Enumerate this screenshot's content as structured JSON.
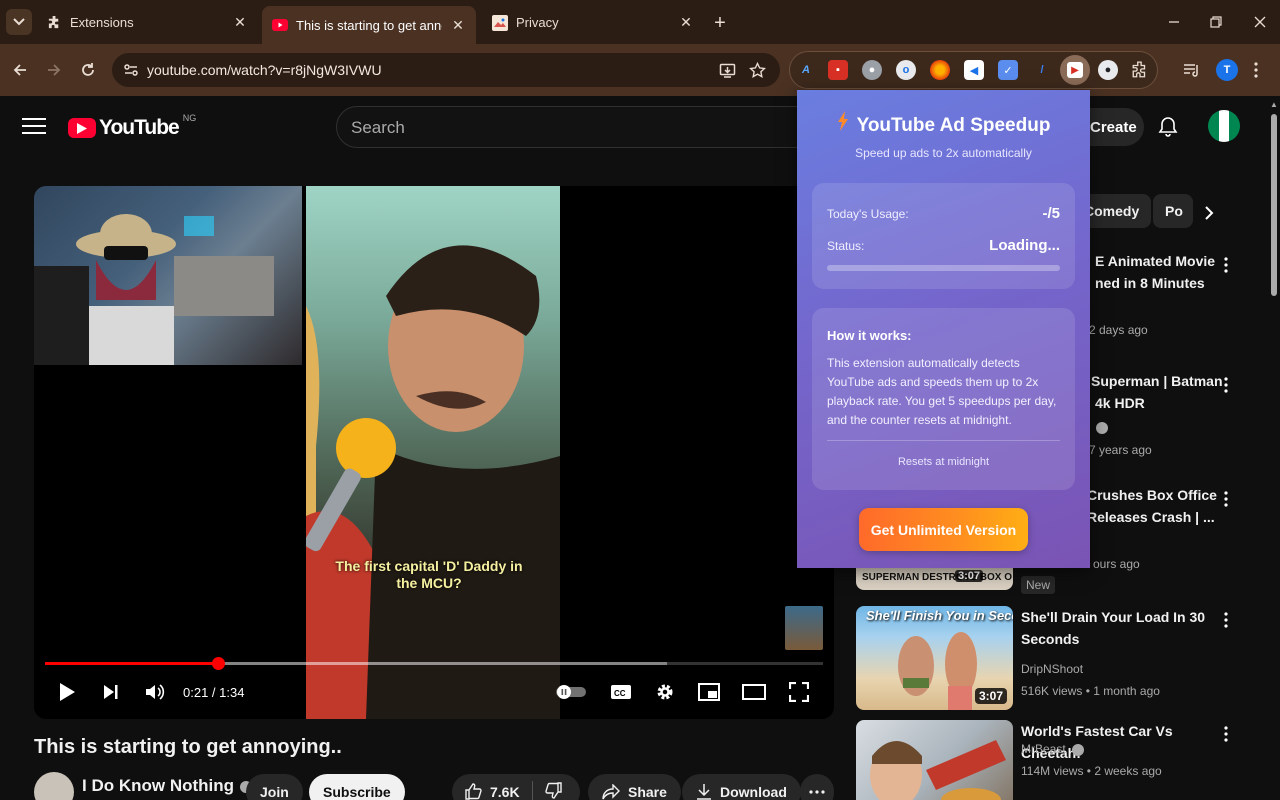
{
  "browser": {
    "tabs": [
      {
        "title": "Extensions",
        "icon": "puzzle-icon",
        "active": false
      },
      {
        "title": "This is starting to get annoying..",
        "icon": "youtube-favicon",
        "active": true
      },
      {
        "title": "Privacy",
        "icon": "privacy-favicon",
        "active": false
      }
    ],
    "url": "youtube.com/watch?v=r8jNgW3IVWU",
    "profile_initial": "T"
  },
  "youtube": {
    "logo_text": "YouTube",
    "country_code": "NG",
    "search_placeholder": "Search",
    "create_label": "Create",
    "chips": [
      "Comedy",
      "Po"
    ],
    "player": {
      "caption": "The first capital 'D' Daddy in the MCU?",
      "time": "0:21 / 1:34",
      "played_fraction": 0.223,
      "buffered_fraction": 0.8
    },
    "video_title": "This is starting to get annoying..",
    "channel_name": "I Do Know Nothing",
    "join_label": "Join",
    "subscribe_label": "Subscribe",
    "like_count": "7.6K",
    "share_label": "Share",
    "download_label": "Download",
    "partial_recs": [
      {
        "line1": "E Animated Movie",
        "line2": "ned in 8 Minutes",
        "meta": "2 days ago"
      },
      {
        "line1": "Superman | Batman",
        "line2": "4k HDR",
        "meta": "7 years ago"
      },
      {
        "line1": "Crushes Box Office",
        "line2": "Releases Crash | ...",
        "meta": "ours ago"
      }
    ],
    "superman_thumb_text": "SUPERMAN DESTROYS BOX O",
    "superman_duration": "3:07",
    "new_badge": "New",
    "recommendations": [
      {
        "title": "She'll Drain Your Load In 30 Seconds",
        "channel": "DripNShoot",
        "meta": "516K views • 1 month ago",
        "duration": "3:07",
        "thumb_text": "She'll Finish You in Seconds"
      },
      {
        "title": "World's Fastest Car Vs Cheetah!",
        "channel": "MrBeast",
        "meta": "114M views • 2 weeks ago",
        "duration": "",
        "thumb_text": ""
      }
    ]
  },
  "extension_popup": {
    "title": "YouTube Ad Speedup",
    "subtitle": "Speed up ads to 2x automatically",
    "usage_label": "Today's Usage:",
    "usage_value": "-/5",
    "status_label": "Status:",
    "status_value": "Loading...",
    "progress_fraction": 0,
    "how_title": "How it works:",
    "how_text": "This extension automatically detects YouTube ads and speeds them up to 2x playback rate. You get 5 speedups per day, and the counter resets at midnight.",
    "reset_note": "Resets at midnight",
    "cta_label": "Get Unlimited Version"
  }
}
